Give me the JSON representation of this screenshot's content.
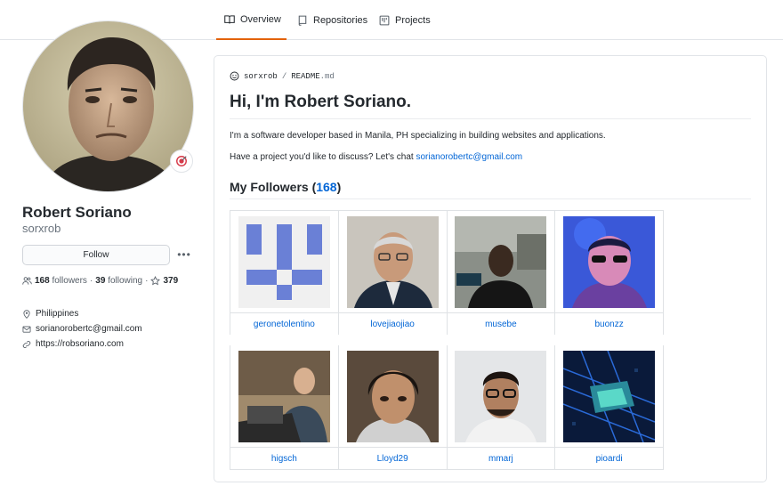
{
  "tabs": [
    {
      "label": "Overview",
      "icon": "book-icon",
      "active": true
    },
    {
      "label": "Repositories",
      "icon": "repo-icon",
      "active": false
    },
    {
      "label": "Projects",
      "icon": "project-icon",
      "active": false
    }
  ],
  "profile": {
    "full_name": "Robert Soriano",
    "username": "sorxrob",
    "follow_label": "Follow",
    "followers_count": "168",
    "followers_label": "followers",
    "following_count": "39",
    "following_label": "following",
    "stars_count": "379",
    "location": "Philippines",
    "email": "sorianorobertc@gmail.com",
    "website": "https://robsoriano.com"
  },
  "readme": {
    "owner": "sorxrob",
    "file": "README",
    "ext": ".md",
    "heading": "Hi, I'm Robert Soriano.",
    "intro": "I'm a software developer based in Manila, PH specializing in building websites and applications.",
    "contact_prefix": "Have a project you'd like to discuss? Let's chat ",
    "contact_email": "sorianorobertc@gmail.com",
    "followers_heading_prefix": "My Followers (",
    "followers_heading_count": "168",
    "followers_heading_suffix": ")"
  },
  "followers": [
    {
      "name": "geronetolentino"
    },
    {
      "name": "lovejiaojiao"
    },
    {
      "name": "musebe"
    },
    {
      "name": "buonzz"
    },
    {
      "name": "higsch"
    },
    {
      "name": "Lloyd29"
    },
    {
      "name": "mmarj"
    },
    {
      "name": "pioardi"
    }
  ],
  "colors": {
    "link": "#0366d6",
    "active_tab": "#e36209",
    "identicon": "#6a80d6"
  }
}
